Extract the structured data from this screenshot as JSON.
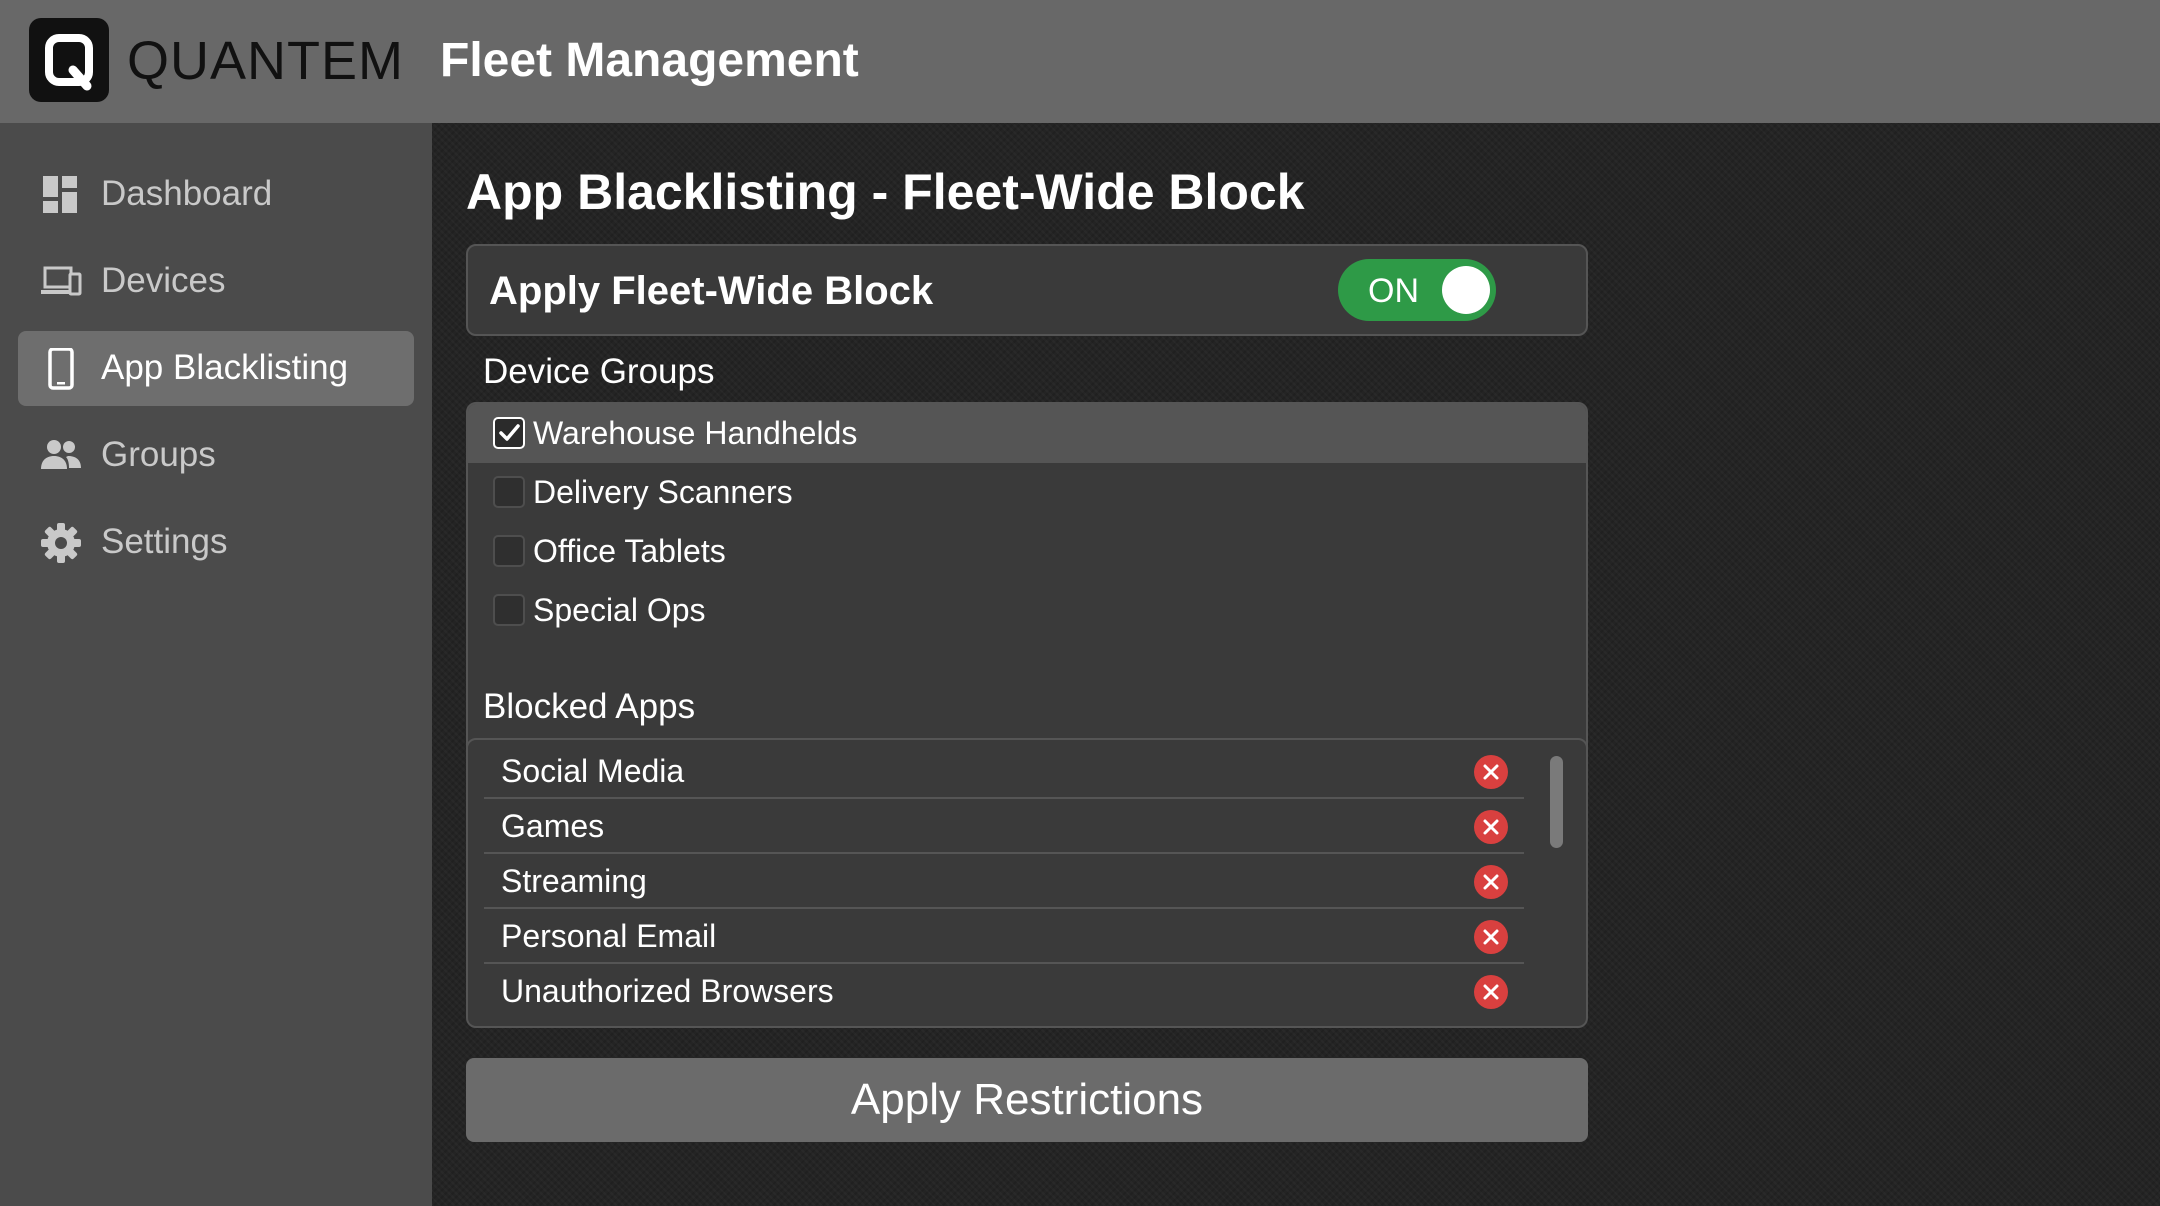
{
  "brand": {
    "logo_letter": "Q",
    "name": "QUANTEM"
  },
  "header": {
    "title": "Fleet Management"
  },
  "sidebar": {
    "items": [
      {
        "label": "Dashboard",
        "icon": "dashboard-icon",
        "active": false
      },
      {
        "label": "Devices",
        "icon": "devices-icon",
        "active": false
      },
      {
        "label": "App Blacklisting",
        "icon": "smartphone-icon",
        "active": true
      },
      {
        "label": "Groups",
        "icon": "people-icon",
        "active": false
      },
      {
        "label": "Settings",
        "icon": "gear-icon",
        "active": false
      }
    ]
  },
  "main": {
    "page_title": "App Blacklisting - Fleet-Wide Block",
    "fleet_block": {
      "label": "Apply Fleet-Wide Block",
      "toggle_text": "ON",
      "enabled": true
    },
    "device_groups": {
      "label": "Device Groups",
      "items": [
        {
          "label": "Warehouse Handhelds",
          "checked": true
        },
        {
          "label": "Delivery Scanners",
          "checked": false
        },
        {
          "label": "Office Tablets",
          "checked": false
        },
        {
          "label": "Special Ops",
          "checked": false
        }
      ]
    },
    "blocked_apps": {
      "label": "Blocked Apps",
      "items": [
        {
          "label": "Social Media",
          "icon": "remove-icon"
        },
        {
          "label": "Games",
          "icon": "remove-icon"
        },
        {
          "label": "Streaming",
          "icon": "remove-icon"
        },
        {
          "label": "Personal Email",
          "icon": "remove-icon"
        },
        {
          "label": "Unauthorized Browsers",
          "icon": "remove-icon"
        }
      ]
    },
    "apply_button": "Apply Restrictions"
  },
  "colors": {
    "header_bg": "#686868",
    "sidebar_bg": "#4b4b4b",
    "active_nav_bg": "#6e6e6e",
    "toggle_on": "#2e9a47",
    "remove_red": "#d9403f",
    "apply_button_bg": "#6b6b6b"
  }
}
